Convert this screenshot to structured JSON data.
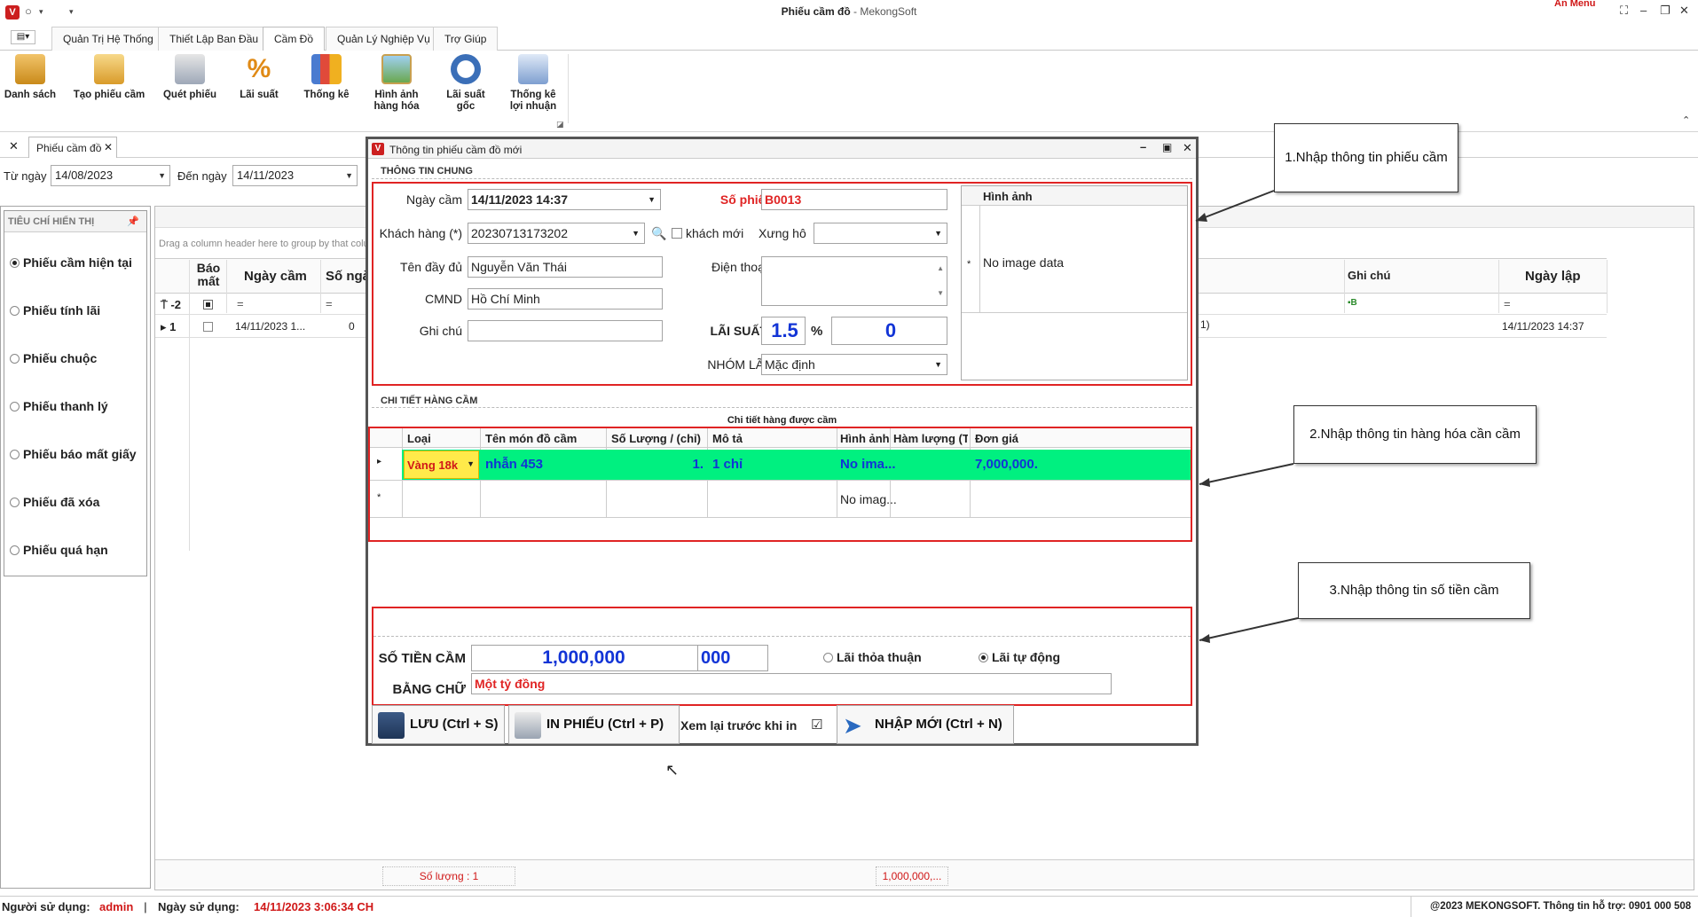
{
  "app": {
    "title_main": "Phiếu cầm đồ",
    "title_suffix": " - MekongSoft",
    "an_menu": "Ẩn Menu"
  },
  "ribbon_tabs": [
    "Quản Trị Hệ Thống",
    "Thiết Lập Ban Đầu",
    "Cầm Đồ",
    "Quản Lý Nghiệp Vụ",
    "Trợ Giúp"
  ],
  "ribbon_buttons": [
    {
      "label1": "Danh sách",
      "label2": "",
      "icon": "clipboard-icon"
    },
    {
      "label1": "Tạo phiếu cầm",
      "label2": "",
      "icon": "edit-form-icon"
    },
    {
      "label1": "Quét phiếu",
      "label2": "",
      "icon": "scan-icon"
    },
    {
      "label1": "Lãi suất",
      "label2": "",
      "icon": "percent-icon"
    },
    {
      "label1": "Thống kê",
      "label2": "",
      "icon": "chart-icon"
    },
    {
      "label1": "Hình ảnh",
      "label2": "hàng hóa",
      "icon": "picture-icon"
    },
    {
      "label1": "Lãi suất",
      "label2": "gốc",
      "icon": "gauge-icon"
    },
    {
      "label1": "Thống kê",
      "label2": "lợi nhuận",
      "icon": "report-icon"
    }
  ],
  "doc_tab": "Phiếu cầm đồ",
  "filter": {
    "from_label": "Từ ngày",
    "from_value": "14/08/2023",
    "to_label": "Đến ngày",
    "to_value": "14/11/2023"
  },
  "left_panel": {
    "header": "TIÊU CHÍ HIỂN THỊ",
    "items": [
      "Phiếu cầm hiện tại",
      "Phiếu tính lãi",
      "Phiếu chuộc",
      "Phiếu thanh lý",
      "Phiếu báo mất giấy",
      "Phiếu đã xóa",
      "Phiếu quá hạn"
    ],
    "selected_index": 0
  },
  "grid": {
    "group_hint": "Drag a column header here to group by that column",
    "col_bao_mat": "Báo mất",
    "col_ngay_cam": "Ngày cầm",
    "col_so_ngay": "Số ngà",
    "col_ghi_chu": "Ghi chú",
    "col_ngay_lap": "Ngày lập",
    "filter_row_num": "-2",
    "filter_eq": "=",
    "row_num": "1",
    "row_ngay_cam": "14/11/2023 1...",
    "row_so": "0",
    "row_partial": "1)",
    "row_ngay_lap": "14/11/2023 14:37",
    "footer_count": "Số lượng : 1",
    "footer_sum": "1,000,000,..."
  },
  "dialog": {
    "title": "Thông tin phiếu cầm đồ mới",
    "section_general": "THÔNG TIN CHUNG",
    "ngay_cam_label": "Ngày cầm",
    "ngay_cam_value": "14/11/2023 14:37",
    "so_phieu_label": "Số phiếu",
    "so_phieu_value": "B0013",
    "khach_hang_label": "Khách hàng (*)",
    "khach_hang_value": "20230713173202",
    "khach_moi_label": "khách mới",
    "xung_ho_label": "Xưng hô",
    "ten_label": "Tên đầy đủ",
    "ten_value": "Nguyễn Văn Thái",
    "dien_thoai_label": "Điện thoại",
    "cmnd_label": "CMND",
    "cmnd_value": "Hồ Chí Minh",
    "ghi_chu_label": "Ghi chú",
    "lai_suat_label": "LÃI SUẤT",
    "lai_suat_value": "1.5",
    "percent": "%",
    "lai_suat_extra": "0",
    "nhom_lai_label": "NHÓM LÃI",
    "nhom_lai_value": "Mặc định",
    "image_header": "Hình ảnh",
    "image_empty": "No image data",
    "section_detail": "CHI TIẾT HÀNG CẦM",
    "detail_caption": "Chi tiết hàng được cầm",
    "detail_cols": [
      "Loại",
      "Tên món đồ cầm",
      "Số Lượng / (chỉ)",
      "Mô tả",
      "Hình ảnh",
      "Hàm lượng (T...",
      "Đơn giá"
    ],
    "detail_row": {
      "loai": "Vàng 18k",
      "ten": "nhẫn 453",
      "so_luong": "1.",
      "mo_ta": "1 chỉ",
      "hinh_anh": "No ima...",
      "ham_luong": "",
      "don_gia": "7,000,000."
    },
    "new_row_image": "No imag...",
    "so_tien_label": "SỐ TIỀN CẦM",
    "so_tien_value": "1,000,000",
    "so_tien_suffix": "000",
    "lai_thoa_thuan": "Lãi thỏa thuận",
    "lai_tu_dong": "Lãi tự động",
    "bang_chu_label": "BẰNG CHỮ",
    "bang_chu_value": "Một tỷ đồng",
    "btn_save": "LƯU (Ctrl + S)",
    "btn_print": "IN PHIẾU (Ctrl + P)",
    "preview_label": "Xem lại trước khi in",
    "btn_new": "NHẬP MỚI (Ctrl + N)"
  },
  "callouts": [
    "1.Nhập thông tin phiếu cầm",
    "2.Nhập thông tin hàng hóa cần cầm",
    "3.Nhập thông tin số tiền cầm"
  ],
  "status": {
    "user_label": "Người sử dụng:",
    "user_value": "admin",
    "date_label": "Ngày sử dụng:",
    "date_value": "14/11/2023 3:06:34 CH",
    "copyright": "@2023 MEKONGSOFT. Thông tin hỗ trợ: 0901 000 508"
  },
  "colors": {
    "accent_red": "#e02424",
    "row_green": "#00f080",
    "loai_yellow": "#ffea4a",
    "value_blue": "#1234d6"
  }
}
